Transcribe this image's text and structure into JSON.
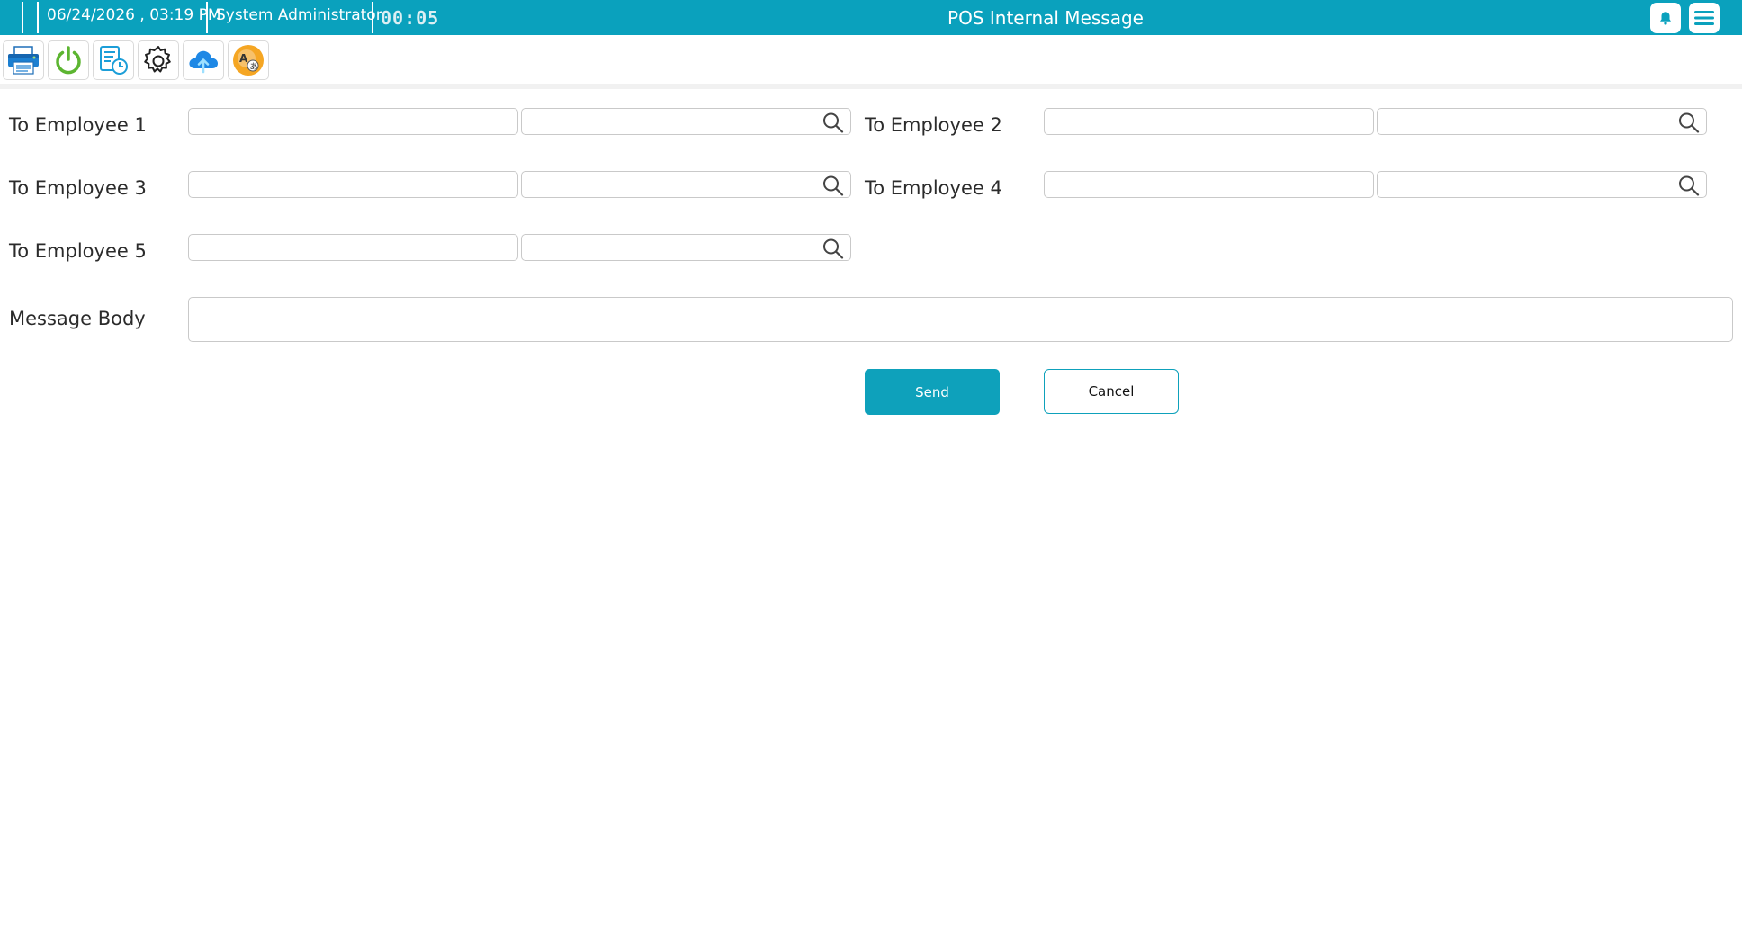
{
  "header": {
    "date_time": "06/24/2026 , 03:19 PM",
    "user": "System Administrator",
    "timer": "00:05",
    "title": "POS Internal Message",
    "bell_icon": "bell-icon",
    "menu_icon": "hamburger-menu-icon",
    "background_color": "#0aa1bd"
  },
  "toolbar": {
    "tools": [
      {
        "name": "printer-icon"
      },
      {
        "name": "power-icon"
      },
      {
        "name": "document-clock-icon"
      },
      {
        "name": "gear-icon"
      },
      {
        "name": "cloud-upload-icon"
      },
      {
        "name": "language-translate-icon"
      }
    ]
  },
  "form": {
    "employees": [
      {
        "label": "To Employee 1",
        "code": "",
        "name": ""
      },
      {
        "label": "To Employee 2",
        "code": "",
        "name": ""
      },
      {
        "label": "To Employee 3",
        "code": "",
        "name": ""
      },
      {
        "label": "To Employee 4",
        "code": "",
        "name": ""
      },
      {
        "label": "To Employee 5",
        "code": "",
        "name": ""
      }
    ],
    "message_body_label": "Message Body",
    "message_body_value": ""
  },
  "actions": {
    "send_label": "Send",
    "cancel_label": "Cancel",
    "accent_color": "#0ea1bb"
  }
}
